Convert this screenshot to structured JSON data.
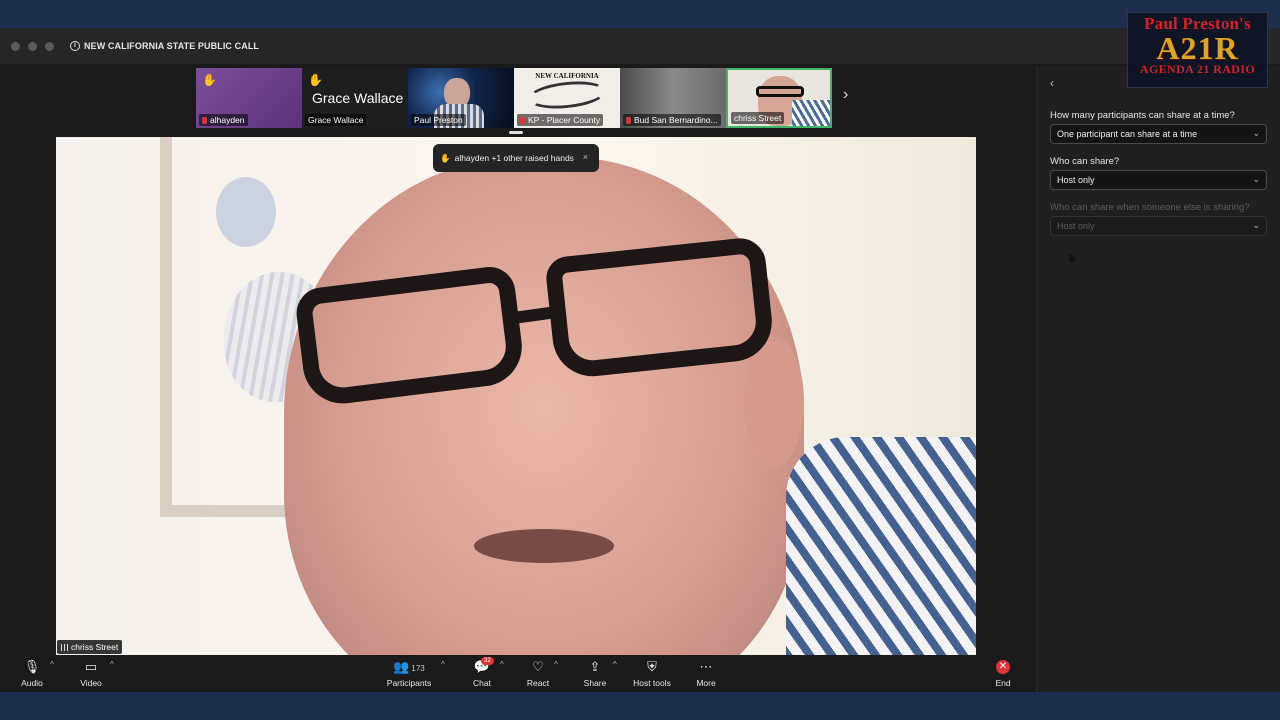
{
  "window": {
    "title": "NEW CALIFORNIA STATE PUBLIC CALL"
  },
  "logo": {
    "top": "Paul Preston's",
    "main": "A21R",
    "sub": "AGENDA 21 RADIO"
  },
  "thumbnails": [
    {
      "name": "alhayden",
      "raised_hand": true,
      "muted": true
    },
    {
      "name": "Grace Wallace",
      "big_name": "Grace Wallace",
      "raised_hand": true
    },
    {
      "name": "Paul Preston"
    },
    {
      "name": "KP - Placer County",
      "poster_title": "NEW CALIFORNIA",
      "muted": true
    },
    {
      "name": "Bud   San Bernardino...",
      "muted": true
    },
    {
      "name": "chriss Street",
      "active_speaker": true
    }
  ],
  "toast": {
    "text": "alhayden +1 other raised hands",
    "close": "×"
  },
  "main_video": {
    "speaker": "chriss Street"
  },
  "panel": {
    "back": "‹",
    "q1": "How many participants can share at a time?",
    "a1": "One participant can share at a time",
    "q2": "Who can share?",
    "a2": "Host only",
    "q3": "Who can share when someone else is sharing?",
    "a3": "Host only"
  },
  "toolbar": {
    "audio": "Audio",
    "video": "Video",
    "participants": "Participants",
    "participants_count": "173",
    "chat": "Chat",
    "chat_badge": "32",
    "react": "React",
    "share": "Share",
    "host_tools": "Host tools",
    "more": "More",
    "end": "End"
  },
  "colors": {
    "accent": "#3fb56a",
    "danger": "#e0333a",
    "hand": "#f3c24a"
  }
}
